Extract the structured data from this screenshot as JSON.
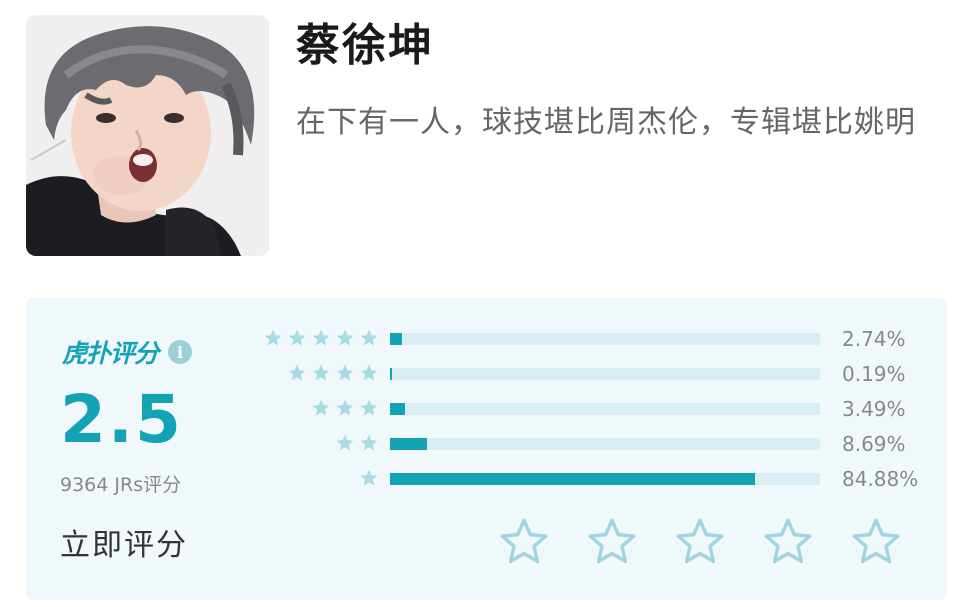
{
  "header": {
    "name": "蔡徐坤",
    "description": "在下有一人，球技堪比周杰伦，专辑堪比姚明"
  },
  "rating": {
    "brand": "虎扑评分",
    "info_icon": "info-icon",
    "score": "2.5",
    "count_text": "9364 JRs评分",
    "rate_now": "立即评分",
    "accent_color": "#13a3b5",
    "rows": [
      {
        "stars": 5,
        "percent_text": "2.74%",
        "fraction": 0.0274
      },
      {
        "stars": 4,
        "percent_text": "0.19%",
        "fraction": 0.0019
      },
      {
        "stars": 3,
        "percent_text": "3.49%",
        "fraction": 0.0349
      },
      {
        "stars": 2,
        "percent_text": "8.69%",
        "fraction": 0.0869
      },
      {
        "stars": 1,
        "percent_text": "84.88%",
        "fraction": 0.8488
      }
    ],
    "rate_stars": 5
  }
}
